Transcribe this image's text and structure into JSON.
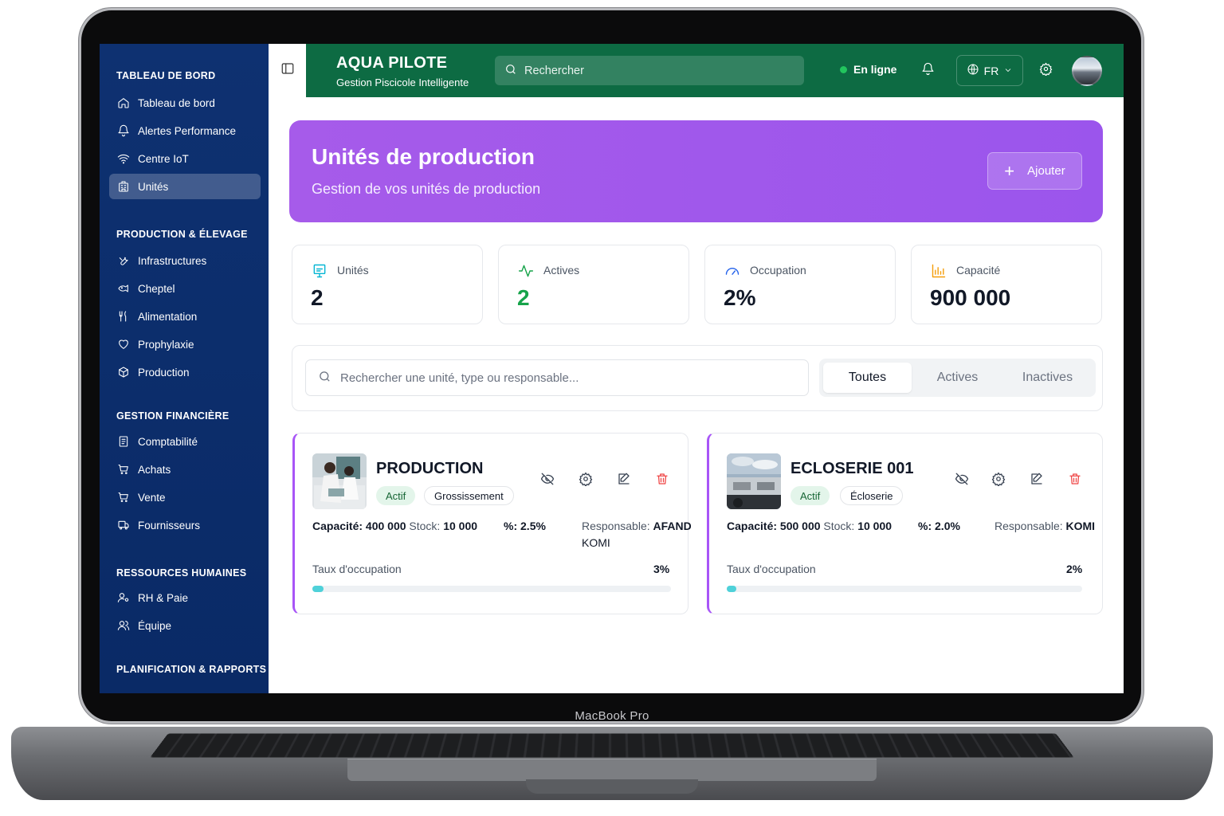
{
  "device": {
    "label": "MacBook Pro"
  },
  "sidebar": {
    "sections": [
      {
        "title": "TABLEAU DE BORD",
        "items": [
          {
            "label": "Tableau de bord",
            "icon": "home-icon"
          },
          {
            "label": "Alertes Performance",
            "icon": "bell-icon"
          },
          {
            "label": "Centre IoT",
            "icon": "wifi-icon"
          },
          {
            "label": "Unités",
            "icon": "building-icon",
            "active": true
          }
        ]
      },
      {
        "title": "PRODUCTION & ÉLEVAGE",
        "items": [
          {
            "label": "Infrastructures",
            "icon": "wrench-icon"
          },
          {
            "label": "Cheptel",
            "icon": "fish-icon"
          },
          {
            "label": "Alimentation",
            "icon": "utensils-icon"
          },
          {
            "label": "Prophylaxie",
            "icon": "heart-icon"
          },
          {
            "label": "Production",
            "icon": "package-icon"
          }
        ]
      },
      {
        "title": "GESTION FINANCIÈRE",
        "items": [
          {
            "label": "Comptabilité",
            "icon": "receipt-icon"
          },
          {
            "label": "Achats",
            "icon": "cart-icon"
          },
          {
            "label": "Vente",
            "icon": "cart-icon"
          },
          {
            "label": "Fournisseurs",
            "icon": "truck-icon"
          }
        ]
      },
      {
        "title": "RESSOURCES HUMAINES",
        "items": [
          {
            "label": "RH & Paie",
            "icon": "user-cog-icon"
          },
          {
            "label": "Équipe",
            "icon": "users-icon"
          }
        ]
      },
      {
        "title": "PLANIFICATION & RAPPORTS",
        "items": []
      }
    ]
  },
  "topbar": {
    "title": "AQUA PILOTE",
    "subtitle": "Gestion Piscicole Intelligente",
    "search_placeholder": "Rechercher",
    "status": "En ligne",
    "language": "FR"
  },
  "hero": {
    "title": "Unités de production",
    "subtitle": "Gestion de vos unités de production",
    "add_label": "Ajouter",
    "gradient": [
      "#a65bea",
      "#9b55ec"
    ]
  },
  "stats": [
    {
      "label": "Unités",
      "value": "2",
      "color": "#06b6d4",
      "icon": "monitor-icon"
    },
    {
      "label": "Actives",
      "value": "2",
      "color": "#16a34a",
      "icon": "activity-icon"
    },
    {
      "label": "Occupation",
      "value": "2%",
      "color": "#2563eb",
      "icon": "gauge-icon"
    },
    {
      "label": "Capacité",
      "value": "900 000",
      "color": "#f59e0b",
      "icon": "bar-chart-icon"
    }
  ],
  "filter": {
    "search_placeholder": "Rechercher une unité, type ou responsable...",
    "tabs": [
      "Toutes",
      "Actives",
      "Inactives"
    ],
    "active_tab": "Toutes"
  },
  "units": [
    {
      "name": "PRODUCTION",
      "status": "Actif",
      "type": "Grossissement",
      "capacity_label": "Capacité:",
      "capacity": "400 000",
      "stock_label": "Stock:",
      "stock": "10 000",
      "pct_label": "%:",
      "pct": "2.5%",
      "resp_label": "Responsable:",
      "resp_line1": "AFANDI",
      "resp_line2": "KOMI",
      "occupancy_label": "Taux d'occupation",
      "occupancy": "3%",
      "occupancy_fraction": 0.03
    },
    {
      "name": "ECLOSERIE 001",
      "status": "Actif",
      "type": "Écloserie",
      "capacity_label": "Capacité:",
      "capacity": "500 000",
      "stock_label": "Stock:",
      "stock": "10 000",
      "pct_label": "%:",
      "pct": "2.0%",
      "resp_label": "Responsable:",
      "resp_line1": "KOMI",
      "resp_line2": "",
      "occupancy_label": "Taux d'occupation",
      "occupancy": "2%",
      "occupancy_fraction": 0.02
    }
  ]
}
